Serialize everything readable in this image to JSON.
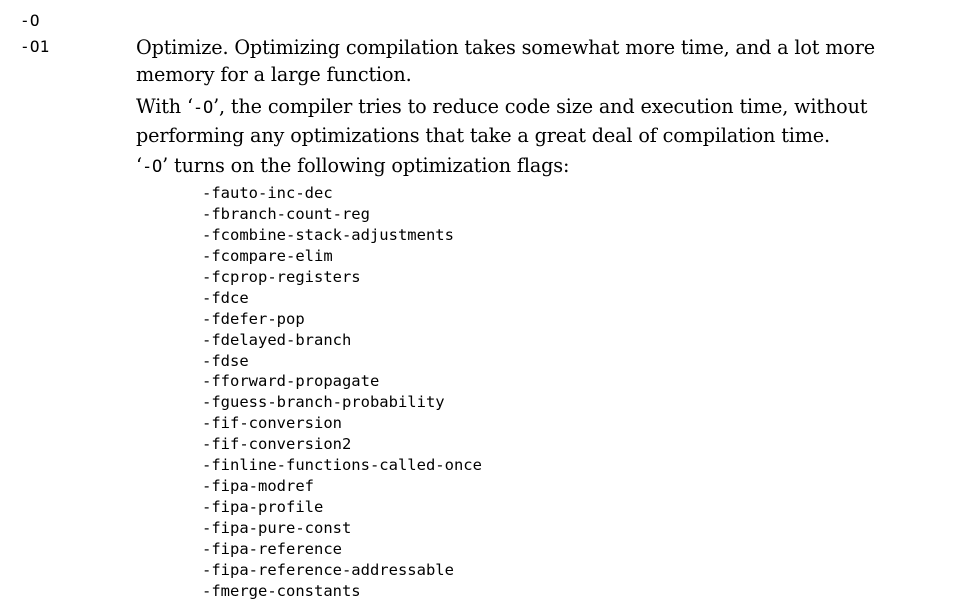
{
  "options": {
    "opt_O": "-O",
    "opt_O1": "-O1"
  },
  "description": {
    "para1": "Optimize. Optimizing compilation takes somewhat more time, and a lot more memory for a large function.",
    "para2_prefix": "With ‘",
    "para2_flag": "-O",
    "para2_suffix": "’, the compiler tries to reduce code size and execution time, without performing any optimizations that take a great deal of compilation time.",
    "para3_prefix": "‘",
    "para3_flag": "-O",
    "para3_suffix": "’ turns on the following optimization flags:"
  },
  "flags": [
    "-fauto-inc-dec",
    "-fbranch-count-reg",
    "-fcombine-stack-adjustments",
    "-fcompare-elim",
    "-fcprop-registers",
    "-fdce",
    "-fdefer-pop",
    "-fdelayed-branch",
    "-fdse",
    "-fforward-propagate",
    "-fguess-branch-probability",
    "-fif-conversion",
    "-fif-conversion2",
    "-finline-functions-called-once",
    "-fipa-modref",
    "-fipa-profile",
    "-fipa-pure-const",
    "-fipa-reference",
    "-fipa-reference-addressable",
    "-fmerge-constants"
  ]
}
